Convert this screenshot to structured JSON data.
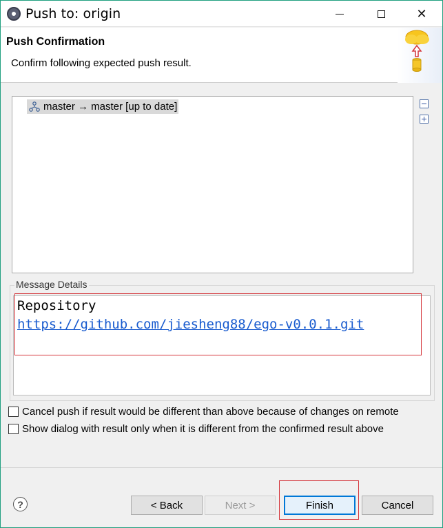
{
  "window": {
    "title": "Push to: origin"
  },
  "banner": {
    "title": "Push Confirmation",
    "description": "Confirm following expected push result."
  },
  "tree": {
    "rows": [
      {
        "label": "master → master [up to date]",
        "icon": "branch-icon"
      }
    ],
    "tools": [
      "collapse-all-icon",
      "expand-all-icon"
    ]
  },
  "message_details": {
    "group_label": "Message Details",
    "repository_label": "Repository",
    "repository_url": "https://github.com/jiesheng88/ego-v0.0.1.git"
  },
  "options": {
    "cancel_if_different": {
      "label": "Cancel push if result would be different than above because of changes on remote",
      "checked": false
    },
    "show_dialog_if_different": {
      "label": "Show dialog with result only when it is different from the confirmed result above",
      "checked": false
    }
  },
  "footer": {
    "help": "?",
    "back_label": "< Back",
    "next_label": "Next >",
    "finish_label": "Finish",
    "cancel_label": "Cancel"
  },
  "colors": {
    "window_border": "#1f9f7f",
    "link": "#1a5ccf",
    "highlight": "#d4343a",
    "default_button_border": "#0078d7"
  }
}
